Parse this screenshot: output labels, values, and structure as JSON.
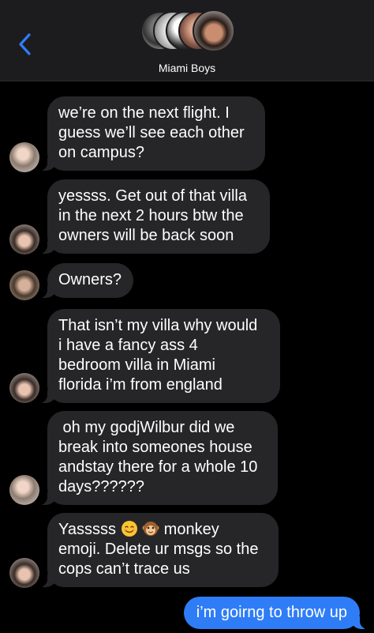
{
  "header": {
    "group_name": "Miami Boys",
    "back_icon": "chevron-left-icon"
  },
  "colors": {
    "incoming_bubble": "#262629",
    "outgoing_bubble": "#2f7df6",
    "back_icon": "#2f7df6"
  },
  "messages": [
    {
      "lines": [
        "we’re on the next flight. I",
        "guess we’ll see each other",
        "on campus?"
      ]
    },
    {
      "lines": [
        "yessss. Get out of that villa",
        "in the next 2 hours btw the",
        "owners will be back soon"
      ]
    },
    {
      "lines": [
        "Owners?"
      ]
    },
    {
      "lines": [
        "That isn’t my villa why would",
        "i have a fancy ass 4",
        "bedroom villa in Miami",
        "florida i’m from england"
      ]
    },
    {
      "lines": [
        " oh my godjWilbur did we",
        "break into someones house",
        "andstay there for a whole 10",
        "days??????"
      ]
    },
    {
      "line1_a": "Yasssss",
      "line1_b": "monkey",
      "emoji_1": "smiling-face-emoji",
      "emoji_2": "monkey-face-emoji",
      "lines_rest": [
        "emoji. Delete ur msgs so the",
        "cops can’t trace us"
      ]
    }
  ],
  "sent_message": "i’m goirng to throw up"
}
